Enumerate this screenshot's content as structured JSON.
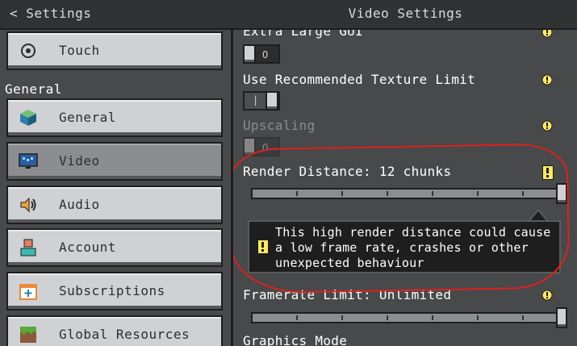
{
  "header": {
    "back_label": "Settings",
    "title": "Video Settings"
  },
  "sidebar": {
    "section_label": "General",
    "items": [
      {
        "label": "Touch",
        "icon": "touch-icon"
      },
      {
        "label": "General",
        "icon": "cube-icon"
      },
      {
        "label": "Video",
        "icon": "monitor-icon",
        "active": true
      },
      {
        "label": "Audio",
        "icon": "speaker-icon"
      },
      {
        "label": "Account",
        "icon": "person-icon"
      },
      {
        "label": "Subscriptions",
        "icon": "calendar-plus-icon"
      },
      {
        "label": "Global Resources",
        "icon": "grass-block-icon"
      }
    ]
  },
  "settings": {
    "extra_large_gui": {
      "label": "Extra Large GUI",
      "state": "off",
      "off_mark": "O"
    },
    "recommended_texture_limit": {
      "label": "Use Recommended Texture Limit",
      "state": "on"
    },
    "upscaling": {
      "label": "Upscaling",
      "state": "off",
      "disabled": true,
      "off_mark": "O"
    },
    "render_distance": {
      "label": "Render Distance: 12 chunks",
      "value_fraction": 1.0,
      "warning": "This high render distance could cause a low frame rate, crashes or other unexpected behaviour"
    },
    "framerate_limit": {
      "label": "Framerate Limit: Unlimited",
      "value_fraction": 1.0
    },
    "graphics_mode": {
      "label": "Graphics Mode"
    }
  },
  "colors": {
    "annotation": "#e02020",
    "warning_yellow": "#ffe866",
    "panel_bg": "#48494a"
  }
}
